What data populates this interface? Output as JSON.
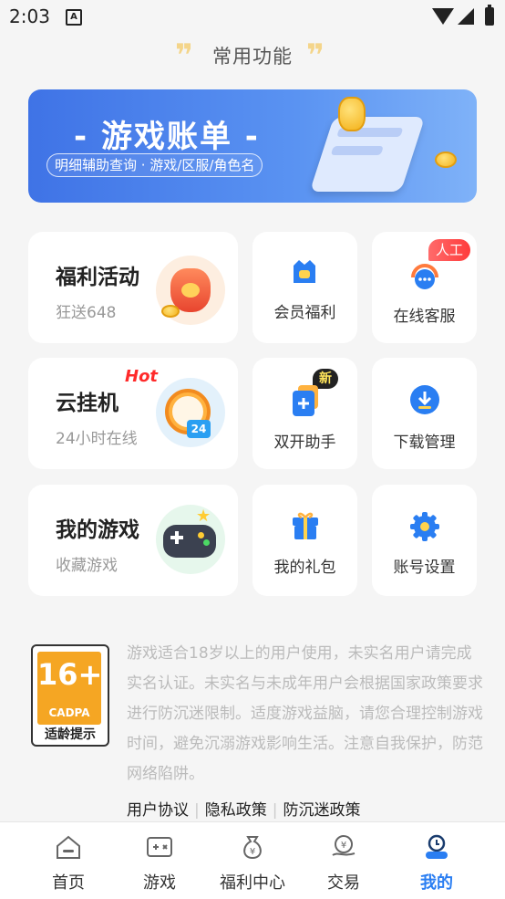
{
  "status_bar": {
    "time": "2:03",
    "notif_letter": "A"
  },
  "section": {
    "title": "常用功能"
  },
  "banner": {
    "title": "- 游戏账单 -",
    "subtitle": "明细辅助查询 · 游戏/区服/角色名"
  },
  "cards": {
    "welfare": {
      "title": "福利活动",
      "subtitle": "狂送648"
    },
    "cloud": {
      "title": "云挂机",
      "subtitle": "24小时在线",
      "hot": "Hot"
    },
    "mygames": {
      "title": "我的游戏",
      "subtitle": "收藏游戏"
    },
    "vip": {
      "label": "会员福利"
    },
    "service": {
      "label": "在线客服",
      "badge": "人工"
    },
    "dual": {
      "label": "双开助手",
      "badge": "新"
    },
    "download": {
      "label": "下载管理"
    },
    "gift": {
      "label": "我的礼包"
    },
    "settings": {
      "label": "账号设置"
    }
  },
  "age_rating": {
    "number": "16+",
    "org": "CADPA",
    "tip": "适龄提示"
  },
  "notice": "游戏适合18岁以上的用户使用，未实名用户请完成实名认证。未实名与未成年用户会根据国家政策要求进行防沉迷限制。适度游戏益脑，请您合理控制游戏时间，避免沉溺游戏影响生活。注意自我保护，防范网络陷阱。",
  "links": [
    "用户协议",
    "隐私政策",
    "防沉迷政策"
  ],
  "tabs": [
    {
      "label": "首页",
      "icon": "home-icon",
      "active": false
    },
    {
      "label": "游戏",
      "icon": "game-icon",
      "active": false
    },
    {
      "label": "福利中心",
      "icon": "welfare-bag-icon",
      "active": false
    },
    {
      "label": "交易",
      "icon": "trade-icon",
      "active": false
    },
    {
      "label": "我的",
      "icon": "profile-icon",
      "active": true
    }
  ],
  "colors": {
    "accent": "#2a7ef2",
    "banner": "#4a82ea",
    "badge_red": "#ff3b3b",
    "age_orange": "#f5a623"
  }
}
